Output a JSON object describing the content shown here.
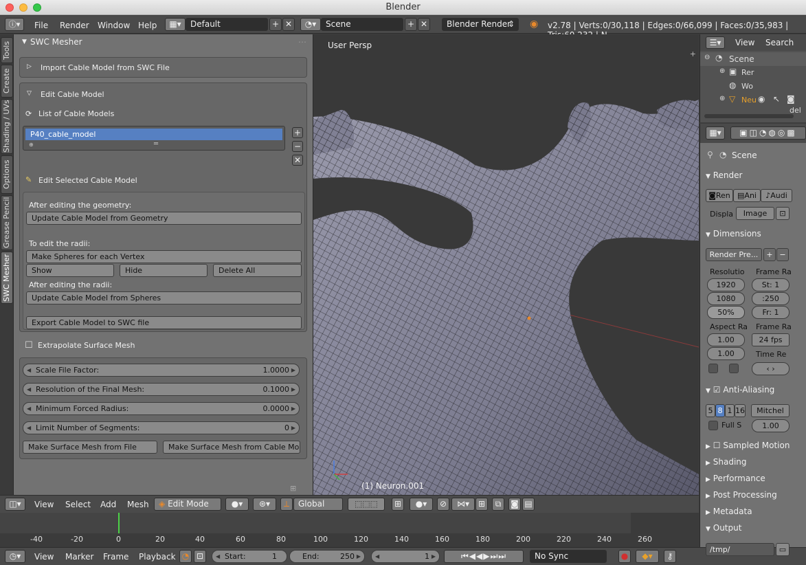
{
  "window": {
    "title": "Blender"
  },
  "menubar": {
    "items": [
      "File",
      "Render",
      "Window",
      "Help"
    ],
    "layout": "Default",
    "scene": "Scene",
    "engine": "Blender Render",
    "stats": "v2.78 | Verts:0/30,118 | Edges:0/66,099 | Faces:0/35,983 | Tris:60,232 | N"
  },
  "tabs": [
    "Tools",
    "Create",
    "Shading / UVs",
    "Options",
    "Grease Pencil",
    "SWC Mesher"
  ],
  "panel": {
    "title": "SWC Mesher",
    "import_label": "Import Cable Model from SWC File",
    "edit_label": "Edit Cable Model",
    "list_label": "List of Cable Models",
    "list_item": "P40_cable_model",
    "edit_selected_label": "Edit Selected Cable Model",
    "after_geometry": "After editing the geometry:",
    "update_geometry": "Update Cable Model from Geometry",
    "to_edit_radii": "To edit the radii:",
    "make_spheres": "Make Spheres for each Vertex",
    "show": "Show",
    "hide": "Hide",
    "delete_all": "Delete All",
    "after_radii": "After editing the radii:",
    "update_spheres": "Update Cable Model from Spheres",
    "export": "Export Cable Model to SWC file",
    "extrapolate": "Extrapolate Surface Mesh",
    "scale_label": "Scale File Factor:",
    "scale_value": "1.0000",
    "resolution_label": "Resolution of the Final Mesh:",
    "resolution_value": "0.1000",
    "min_radius_label": "Minimum Forced Radius:",
    "min_radius_value": "0.0000",
    "limit_label": "Limit Number of Segments:",
    "limit_value": "0",
    "make_from_file": "Make Surface Mesh from File",
    "make_from_cable": "Make Surface Mesh from Cable Mo..."
  },
  "viewport": {
    "view_label": "User Persp",
    "object_label": "(1) Neuron.001"
  },
  "view3d_header": {
    "menus": [
      "View",
      "Select",
      "Add",
      "Mesh"
    ],
    "mode": "Edit Mode",
    "orientation": "Global"
  },
  "timeline": {
    "ticks": [
      "-40",
      "-20",
      "0",
      "20",
      "40",
      "60",
      "80",
      "100",
      "120",
      "140",
      "160",
      "180",
      "200",
      "220",
      "240",
      "260"
    ]
  },
  "footer": {
    "menus": [
      "View",
      "Marker",
      "Frame",
      "Playback"
    ],
    "start_label": "Start:",
    "start_value": "1",
    "end_label": "End:",
    "end_value": "250",
    "current": "1",
    "sync": "No Sync"
  },
  "outliner": {
    "view": "View",
    "search": "Search",
    "items": [
      "Scene",
      "Rer",
      "Wo",
      "Neu",
      "del"
    ]
  },
  "properties": {
    "context": "Scene",
    "render_title": "Render",
    "render_buttons": [
      "Ren",
      "Ani",
      "Audi"
    ],
    "display_label": "Displa",
    "display_value": "Image",
    "dimensions_title": "Dimensions",
    "preset": "Render Pre...",
    "resolution_label": "Resolutio",
    "frame_range_label": "Frame Ra",
    "res_x": "1920",
    "res_y": "1080",
    "res_pct": "50%",
    "start": "St: 1",
    "end": ":250",
    "step": "Fr: 1",
    "aspect_label": "Aspect Ra",
    "frame_rate_label": "Frame Ra",
    "aspect_x": "1.00",
    "aspect_y": "1.00",
    "fps": "24 fps",
    "time_remap_label": "Time Re",
    "aa_title": "Anti-Aliasing",
    "aa_samples": [
      "5",
      "8",
      "1",
      "16"
    ],
    "aa_filter": "Mitchel",
    "full_sample": "Full S",
    "filter_size": "1.00",
    "sampled_motion": "Sampled Motion",
    "shading": "Shading",
    "performance": "Performance",
    "post_processing": "Post Processing",
    "metadata": "Metadata",
    "output": "Output",
    "output_path": "/tmp/"
  }
}
